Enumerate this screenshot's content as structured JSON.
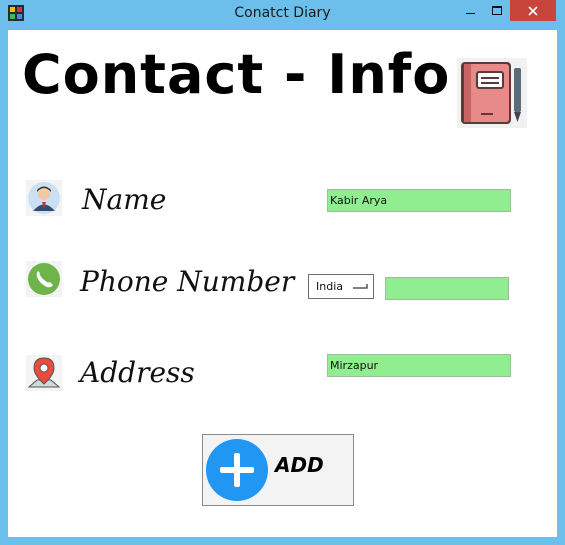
{
  "window": {
    "title": "Conatct Diary"
  },
  "form": {
    "heading": "Contact - Info",
    "name_label": "Name",
    "name_value": "Kabir Arya",
    "phone_label": "Phone Number",
    "country_value": "India",
    "phone_value": "",
    "address_label": "Address",
    "address_value": "Mirzapur",
    "add_label": "ADD"
  },
  "icons": {
    "book": "notebook-icon",
    "name": "user-avatar-icon",
    "phone": "phone-icon",
    "address": "map-pin-icon",
    "add": "plus-icon"
  },
  "colors": {
    "titlebar": "#6cbfea",
    "field_bg": "#90ee90",
    "close_btn": "#c7453a",
    "add_circle": "#2196f3"
  }
}
